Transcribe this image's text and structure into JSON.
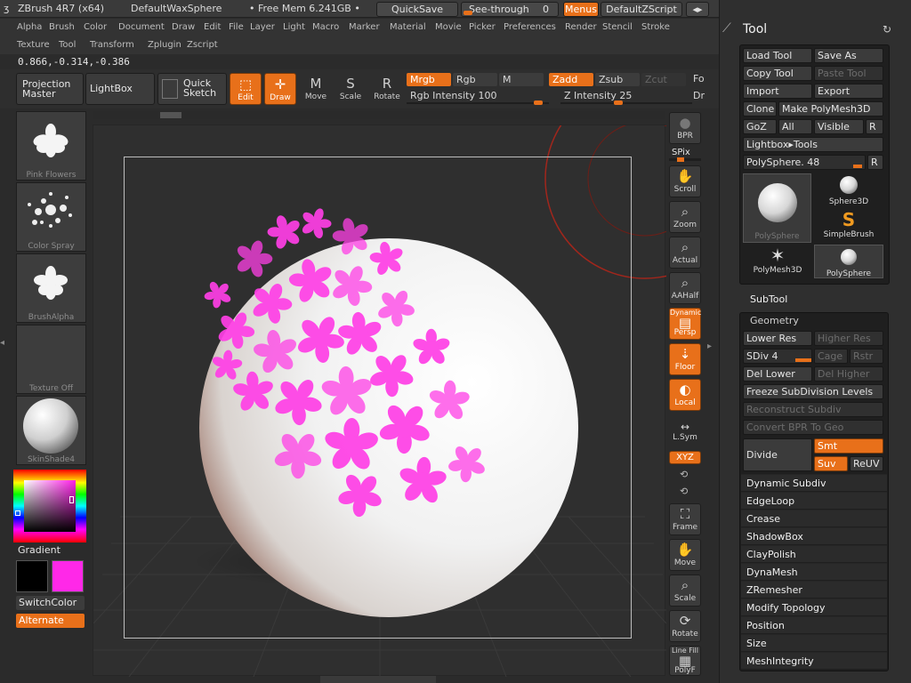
{
  "titlebar": {
    "app": "ZBrush 4R7 (x64)",
    "document": "DefaultWaxSphere",
    "freemem": "• Free Mem 6.241GB •",
    "quicksave": "QuickSave",
    "seethrough": "See-through",
    "seethrough_value": "0",
    "menus": "Menus",
    "script": "DefaultZScript"
  },
  "menus": {
    "row1": [
      "Alpha",
      "Brush",
      "Color",
      "Document",
      "Draw",
      "Edit",
      "File",
      "Layer",
      "Light",
      "Macro",
      "Marker",
      "Material",
      "Movie",
      "Picker",
      "Preferences",
      "Render",
      "Stencil",
      "Stroke"
    ],
    "row2": [
      "Texture",
      "Tool",
      "Transform",
      "Zplugin",
      "Zscript"
    ]
  },
  "coords": "0.866,-0.314,-0.386",
  "toolbar": {
    "projection_master": "Projection Master",
    "lightbox": "LightBox",
    "quick_sketch": "Quick Sketch",
    "edit": "Edit",
    "draw": "Draw",
    "move": "Move",
    "scale": "Scale",
    "rotate": "Rotate",
    "mrgb": "Mrgb",
    "rgb": "Rgb",
    "m": "M",
    "zadd": "Zadd",
    "zsub": "Zsub",
    "zcut": "Zcut",
    "rgb_intensity": "Rgb Intensity 100",
    "z_intensity": "Z Intensity 25",
    "fo": "Fo",
    "dr": "Dr"
  },
  "shelf": {
    "brush_alpha_label": "Pink Flowers",
    "stroke_label": "Color Spray",
    "alpha_label": "BrushAlpha",
    "texture_label": "Texture Off",
    "material_label": "SkinShade4",
    "gradient": "Gradient",
    "switchcolor": "SwitchColor",
    "alternate": "Alternate"
  },
  "rightstrip": {
    "bpr": "BPR",
    "spix": "SPix",
    "scroll": "Scroll",
    "zoom": "Zoom",
    "actual": "Actual",
    "aahalf": "AAHalf",
    "dynamic": "Dynamic",
    "persp": "Persp",
    "floor": "Floor",
    "local": "Local",
    "lsym": "L.Sym",
    "xyz": "XYZ",
    "frame": "Frame",
    "move": "Move",
    "scale": "Scale",
    "rotate": "Rotate",
    "linefill": "Line Fill",
    "polyf": "PolyF"
  },
  "panel": {
    "title": "Tool",
    "load_tool": "Load Tool",
    "save_as": "Save As",
    "copy_tool": "Copy Tool",
    "paste_tool": "Paste Tool",
    "import": "Import",
    "export": "Export",
    "clone": "Clone",
    "make_polymesh": "Make PolyMesh3D",
    "goz": "GoZ",
    "all": "All",
    "visible": "Visible",
    "r": "R",
    "lightbox_tools": "Lightbox▸Tools",
    "polysphere": "PolySphere. 48",
    "tools": [
      "PolySphere",
      "Sphere3D",
      "SimpleBrush",
      "PolyMesh3D",
      "PolySphere"
    ],
    "subtool": "SubTool",
    "geometry": "Geometry",
    "lower_res": "Lower Res",
    "higher_res": "Higher Res",
    "sdiv": "SDiv 4",
    "cage": "Cage",
    "rstr": "Rstr",
    "del_lower": "Del Lower",
    "del_higher": "Del Higher",
    "freeze": "Freeze SubDivision Levels",
    "reconstruct": "Reconstruct Subdiv",
    "convert_bpr": "Convert BPR To Geo",
    "divide": "Divide",
    "smt": "Smt",
    "suv": "Suv",
    "reuv": "ReUV",
    "subs": [
      "Dynamic Subdiv",
      "EdgeLoop",
      "Crease",
      "ShadowBox",
      "ClayPolish",
      "DynaMesh",
      "ZRemesher",
      "Modify Topology",
      "Position",
      "Size",
      "MeshIntegrity"
    ]
  },
  "colors": {
    "accent": "#e8701a",
    "primary_color": "#000000",
    "secondary_color": "#ff28e8",
    "paint": "#ff3fe6"
  }
}
